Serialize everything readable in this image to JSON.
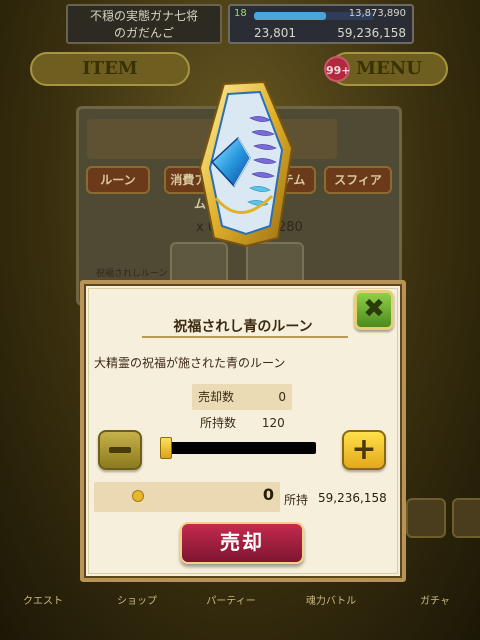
{
  "header": {
    "player_name_line1": "不穏の実態ガナ七将",
    "player_name_line2": "のガだんご",
    "level": "18",
    "exp": "13,873,890",
    "gems": "23,801",
    "gold": "59,236,158"
  },
  "menu": {
    "item_label": "ITEM",
    "menu_label": "MENU",
    "badge_count": "99+"
  },
  "inventory": {
    "tabs": [
      "ルーン",
      "消費アイテム",
      "アイテム",
      "スフィア"
    ],
    "count_left": "x 0",
    "count_right": "280",
    "rune_label": "祝福されしルーン"
  },
  "dialog": {
    "title": "祝福されし青のルーン",
    "description": "大精霊の祝福が施された青のルーン",
    "sold_label": "売却数",
    "sold_value": "0",
    "owned_label": "所持数",
    "owned_value": "120",
    "close_glyph": "✖",
    "minus_label": "−",
    "plus_label": "+",
    "slider_level": 0,
    "sale_amount": "0",
    "possession_label": "所持",
    "money_value": "59,236,158",
    "sell_label": "売却"
  },
  "nav": {
    "items": [
      "クエスト",
      "ショップ",
      "パーティー",
      "魂力バトル",
      "ガチャ"
    ]
  },
  "colors": {
    "dialog_bg": "#f6efdb",
    "dialog_border": "#b89355",
    "close_green": "#6cb234",
    "plus_yellow": "#ffd21f",
    "sell_red": "#a81f40",
    "rune_blue": "#2a9be0",
    "rune_gold": "#e0b12a"
  }
}
